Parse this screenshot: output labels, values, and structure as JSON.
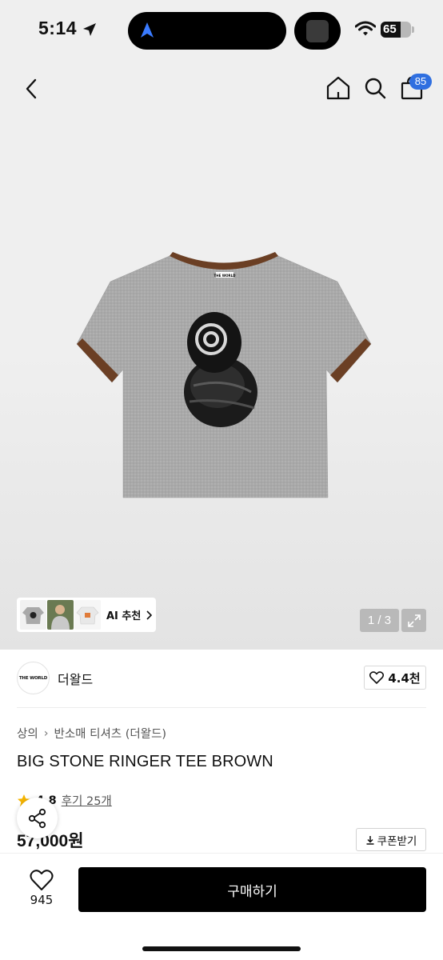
{
  "status_bar": {
    "time": "5:14",
    "battery_level": "65",
    "battery_fraction": 0.65
  },
  "nav": {
    "cart_badge": "85",
    "icons": [
      "back-icon",
      "home-icon",
      "search-icon",
      "bag-icon"
    ]
  },
  "gallery": {
    "pager": "1 / 3",
    "ai_label": "AI 추천",
    "tee_print_text": "THE WORLD",
    "colors": {
      "tee": "#a8a8a8",
      "trim": "#6b3f24"
    }
  },
  "brand": {
    "logo_text": "THE WORLD",
    "name": "더왈드",
    "likes": "4.4천"
  },
  "product": {
    "breadcrumb": [
      "상의",
      "반소매 티셔츠 (더왈드)"
    ],
    "title": "BIG STONE RINGER TEE BROWN",
    "rating": "4.8",
    "reviews": "후기 25개",
    "price": "57,000원",
    "coupon_label": "쿠폰받기"
  },
  "bottom": {
    "wish_count": "945",
    "buy_label": "구매하기"
  },
  "colors": {
    "accent": "#2f6fe0",
    "star": "#f5b400"
  }
}
